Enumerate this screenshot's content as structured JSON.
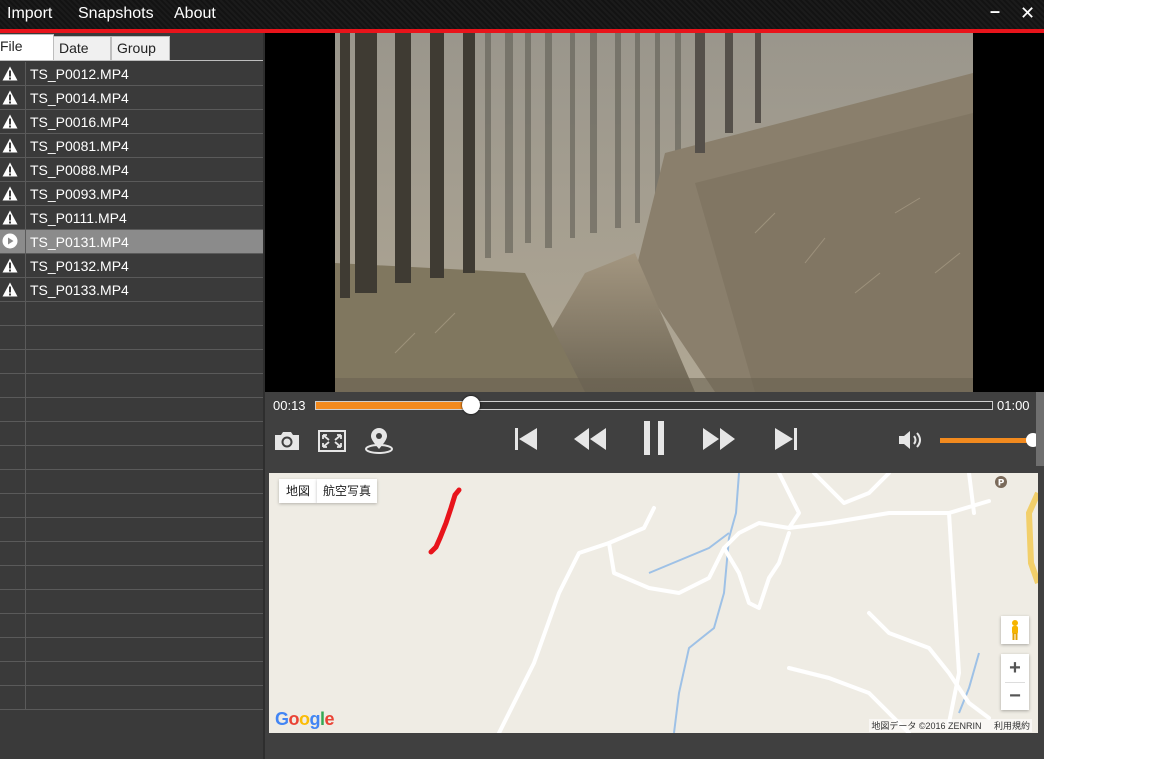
{
  "menu": {
    "import": "Import",
    "snapshots": "Snapshots",
    "about": "About"
  },
  "window": {
    "minimize": "–",
    "close": "✕"
  },
  "tabs": [
    "File",
    "Date",
    "Group"
  ],
  "files": [
    {
      "name": "TS_P0012.MP4",
      "icon": "warning-icon"
    },
    {
      "name": "TS_P0014.MP4",
      "icon": "warning-icon"
    },
    {
      "name": "TS_P0016.MP4",
      "icon": "warning-icon"
    },
    {
      "name": "TS_P0081.MP4",
      "icon": "warning-icon"
    },
    {
      "name": "TS_P0088.MP4",
      "icon": "warning-icon"
    },
    {
      "name": "TS_P0093.MP4",
      "icon": "warning-icon"
    },
    {
      "name": "TS_P0111.MP4",
      "icon": "warning-icon"
    },
    {
      "name": "TS_P0131.MP4",
      "icon": "play-icon",
      "selected": true
    },
    {
      "name": "TS_P0132.MP4",
      "icon": "warning-icon"
    },
    {
      "name": "TS_P0133.MP4",
      "icon": "warning-icon"
    }
  ],
  "player": {
    "current_time": "00:13",
    "total_time": "01:00",
    "progress_fraction": 0.23,
    "volume_fraction": 1.0
  },
  "map": {
    "type_map": "地図",
    "type_satellite": "航空写真",
    "attribution": "地図データ ©2016 ZENRIN",
    "terms": "利用規約",
    "zoom_in": "+",
    "zoom_out": "−",
    "logo": "Google"
  },
  "colors": {
    "accent": "#f28a1e",
    "title_red": "#e8141b",
    "route": "#e8141b"
  }
}
